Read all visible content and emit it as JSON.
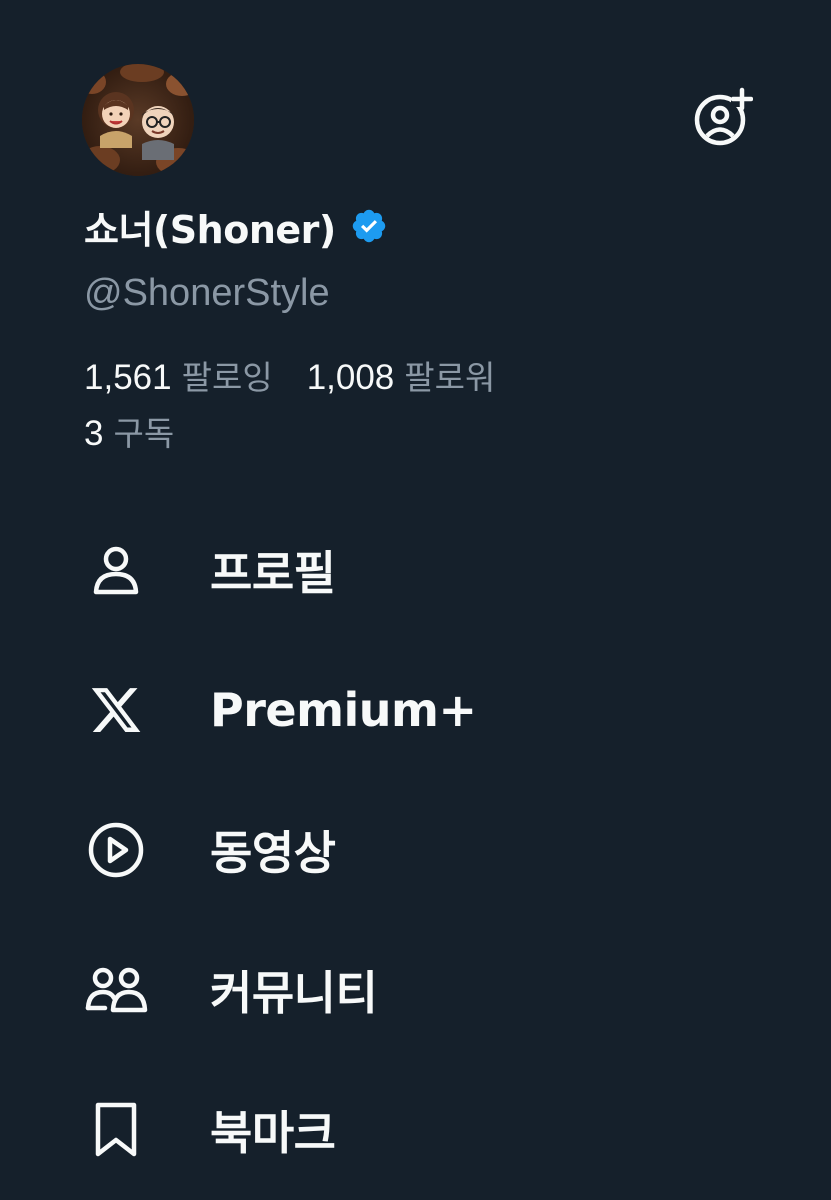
{
  "profile": {
    "display_name": "쇼너(Shoner)",
    "handle": "@ShonerStyle",
    "verified": true,
    "verified_color": "#1d9bf0"
  },
  "stats": {
    "following": {
      "count": "1,561",
      "label": "팔로잉"
    },
    "followers": {
      "count": "1,008",
      "label": "팔로워"
    },
    "subscriptions": {
      "count": "3",
      "label": "구독"
    }
  },
  "menu": {
    "items": [
      {
        "label": "프로필",
        "icon": "person-icon"
      },
      {
        "label": "Premium+",
        "icon": "x-logo-icon"
      },
      {
        "label": "동영상",
        "icon": "play-circle-icon"
      },
      {
        "label": "커뮤니티",
        "icon": "communities-icon"
      },
      {
        "label": "북마크",
        "icon": "bookmark-icon"
      }
    ]
  },
  "header": {
    "add_account_icon": "add-account-icon"
  },
  "colors": {
    "background": "#15202b",
    "primary_text": "#f7f9f9",
    "secondary_text": "#8b98a5"
  }
}
